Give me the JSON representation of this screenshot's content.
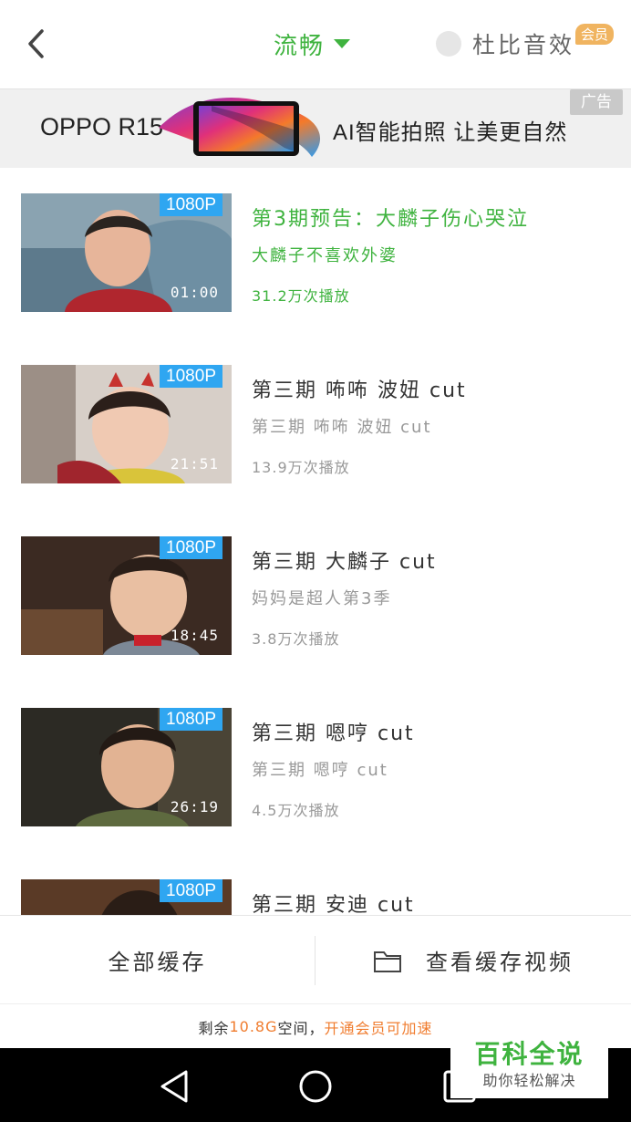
{
  "header": {
    "quality_label": "流畅",
    "dolby_label": "杜比音效",
    "vip_badge": "会员"
  },
  "ad": {
    "brand": "OPPO R15",
    "slogan": "AI智能拍照  让美更自然",
    "tag": "广告"
  },
  "videos": [
    {
      "resolution": "1080P",
      "duration": "01:00",
      "title": "第3期预告：大麟子伤心哭泣",
      "subtitle": "大麟子不喜欢外婆",
      "plays": "31.2万次播放"
    },
    {
      "resolution": "1080P",
      "duration": "21:51",
      "title": "第三期 咘咘 波妞 cut",
      "subtitle": "第三期 咘咘 波妞 cut",
      "plays": "13.9万次播放"
    },
    {
      "resolution": "1080P",
      "duration": "18:45",
      "title": "第三期 大麟子 cut",
      "subtitle": "妈妈是超人第3季",
      "plays": "3.8万次播放"
    },
    {
      "resolution": "1080P",
      "duration": "26:19",
      "title": "第三期 嗯哼 cut",
      "subtitle": "第三期 嗯哼 cut",
      "plays": "4.5万次播放"
    },
    {
      "resolution": "1080P",
      "title": "第三期 安迪 cut"
    }
  ],
  "actions": {
    "cache_all": "全部缓存",
    "view_cached": "查看缓存视频"
  },
  "storage": {
    "prefix": "剩余",
    "space": "10.8G",
    "suffix": "空间，",
    "link": "开通会员可加速"
  },
  "watermark": {
    "title": "百科全说",
    "subtitle": "助你轻松解决"
  },
  "colors": {
    "accent": "#3fb33f",
    "badge_blue": "#2fa6f1",
    "vip_orange": "#f0b460",
    "link_orange": "#f07c2e"
  }
}
